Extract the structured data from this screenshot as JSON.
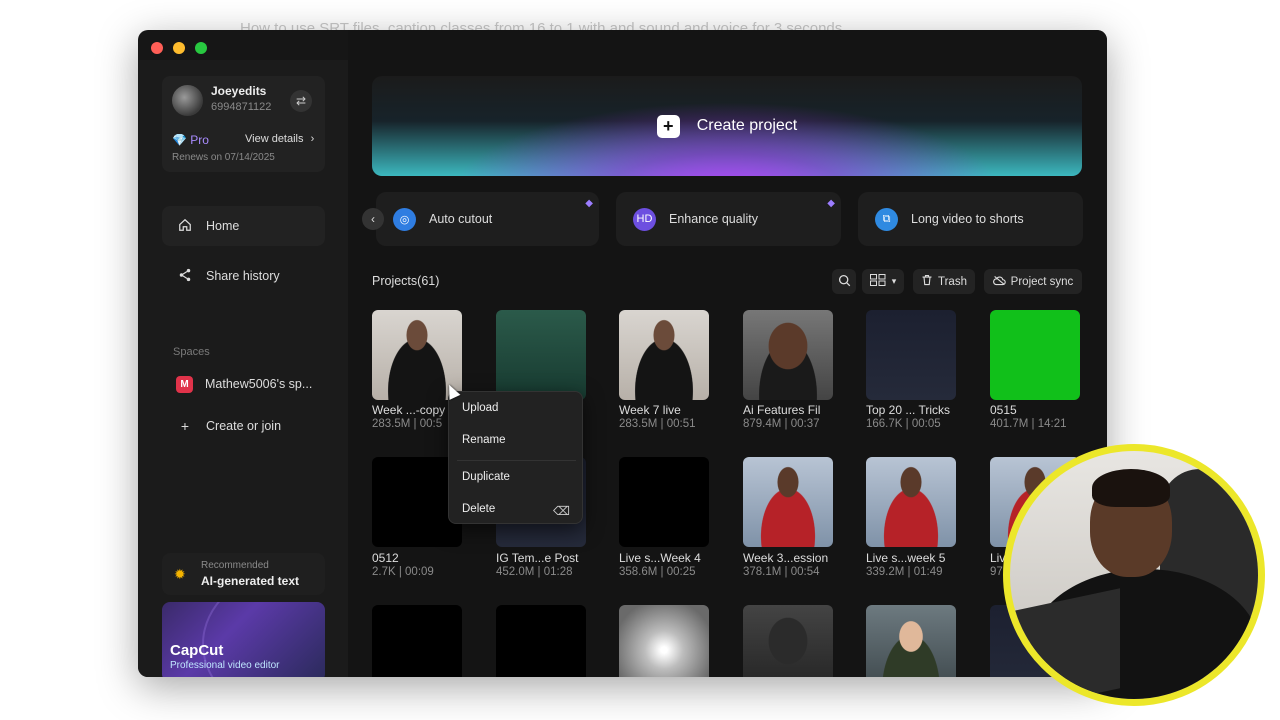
{
  "caption": "How to use SRT files, caption classes from 16 to 1 with and sound and voice for 3 seconds",
  "account": {
    "name": "Joeyedits",
    "id": "6994871122",
    "plan": "Pro",
    "view_details": "View details",
    "renews": "Renews on 07/14/2025"
  },
  "nav": {
    "home": "Home",
    "share_history": "Share history",
    "spaces_label": "Spaces",
    "space_initial": "M",
    "space_name": "Mathew5006's sp...",
    "create_or_join": "Create or join"
  },
  "recommended": {
    "small": "Recommended",
    "big": "AI-generated text"
  },
  "promo": {
    "title": "CapCut",
    "subtitle": "Professional video editor"
  },
  "hero": {
    "label": "Create project"
  },
  "tools": [
    {
      "label": "Auto cutout"
    },
    {
      "label": "Enhance quality"
    },
    {
      "label": "Long video to shorts"
    }
  ],
  "toolbar": {
    "projects_title": "Projects(61)",
    "trash": "Trash",
    "project_sync": "Project sync"
  },
  "projects": [
    {
      "title": "Week ...-copy",
      "meta": "283.5M | 00:5"
    },
    {
      "title": "",
      "meta": ""
    },
    {
      "title": "Week 7 live",
      "meta": "283.5M | 00:51"
    },
    {
      "title": "Ai Features Fil",
      "meta": "879.4M | 00:37"
    },
    {
      "title": "Top 20 ... Tricks",
      "meta": "166.7K | 00:05"
    },
    {
      "title": "0515",
      "meta": "401.7M | 14:21"
    },
    {
      "title": "0512",
      "meta": "2.7K | 00:09"
    },
    {
      "title": "IG Tem...e Post",
      "meta": "452.0M | 01:28"
    },
    {
      "title": "Live s...Week 4",
      "meta": "358.6M | 00:25"
    },
    {
      "title": "Week 3...ession",
      "meta": "378.1M | 00:54"
    },
    {
      "title": "Live s...week 5",
      "meta": "339.2M | 01:49"
    },
    {
      "title": "Liv",
      "meta": "97"
    }
  ],
  "context_menu": {
    "upload": "Upload",
    "rename": "Rename",
    "duplicate": "Duplicate",
    "delete": "Delete"
  }
}
